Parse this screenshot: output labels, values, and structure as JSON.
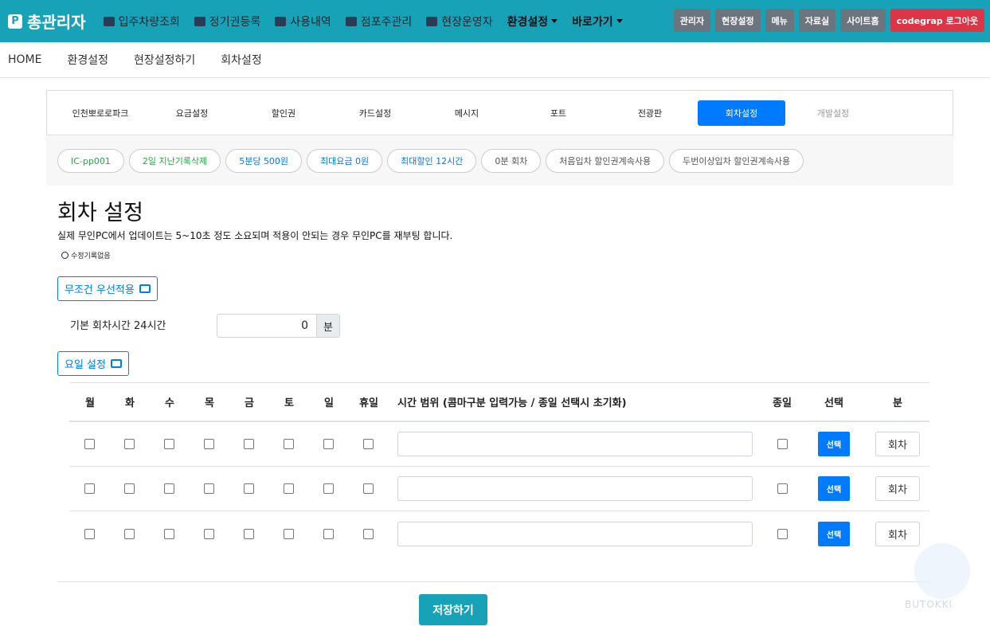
{
  "brand": {
    "logo": "P",
    "title": "총관리자"
  },
  "nav": [
    {
      "label": "입주차량조회",
      "icon": "car-icon"
    },
    {
      "label": "정기권등록",
      "icon": "card-icon"
    },
    {
      "label": "사용내역",
      "icon": "printer-icon"
    },
    {
      "label": "점포주관리",
      "icon": "store-icon"
    },
    {
      "label": "현장운영자",
      "icon": "user-monitor-icon"
    },
    {
      "label": "환경설정",
      "dropdown": true
    },
    {
      "label": "바로가기",
      "dropdown": true
    }
  ],
  "topbuttons": [
    "관리자",
    "현장설정",
    "메뉴",
    "자료실",
    "사이트홈",
    "codegrap 로그아웃"
  ],
  "breadcrumb": [
    "HOME",
    "환경설정",
    "현장설정하기",
    "회차설정"
  ],
  "tabs": [
    "인천뽀로로파크",
    "요금설정",
    "할인권",
    "카드설정",
    "메시지",
    "포트",
    "전광판",
    "회차설정",
    "개발설정"
  ],
  "pills": [
    {
      "label": "IC-pp001",
      "tone": "green"
    },
    {
      "label": "2일 지난기록삭제",
      "tone": "green"
    },
    {
      "label": "5분당 500원",
      "tone": "blue"
    },
    {
      "label": "최대요금 0원",
      "tone": "blue"
    },
    {
      "label": "최대할인 12시간",
      "tone": "blue"
    },
    {
      "label": "0분 회차",
      "tone": "gray"
    },
    {
      "label": "처음입차 할인권계속사용",
      "tone": "gray"
    },
    {
      "label": "두번이상입차 할인권계속사용",
      "tone": "gray"
    }
  ],
  "page": {
    "title": "회차 설정",
    "desc": "실제 무인PC에서 업데이트는 5~10초 정도 소요되며 적용이 안되는 경우 무인PC를 재부팅 합니다.",
    "editlog": "수정기록없음",
    "priority_btn": "무조건 우선적용",
    "base_label": "기본 회차시간 24시간",
    "base_value": "0",
    "base_unit": "분",
    "day_btn": "요일 설정"
  },
  "table": {
    "headers": [
      "월",
      "화",
      "수",
      "목",
      "금",
      "토",
      "일",
      "휴일",
      "시간 범위 (콤마구분 입력가능 / 종일 선택시 초기화)",
      "종일",
      "선택",
      "분"
    ],
    "rows": [
      {
        "select": "선택",
        "unit": "회차"
      },
      {
        "select": "선택",
        "unit": "회차"
      },
      {
        "select": "선택",
        "unit": "회차"
      }
    ]
  },
  "save": "저장하기",
  "watermark": "BUTOKKI",
  "colors": {
    "primary": "#17a2b8",
    "blue": "#007bff",
    "danger": "#dc3545",
    "gray": "#6c757d"
  }
}
